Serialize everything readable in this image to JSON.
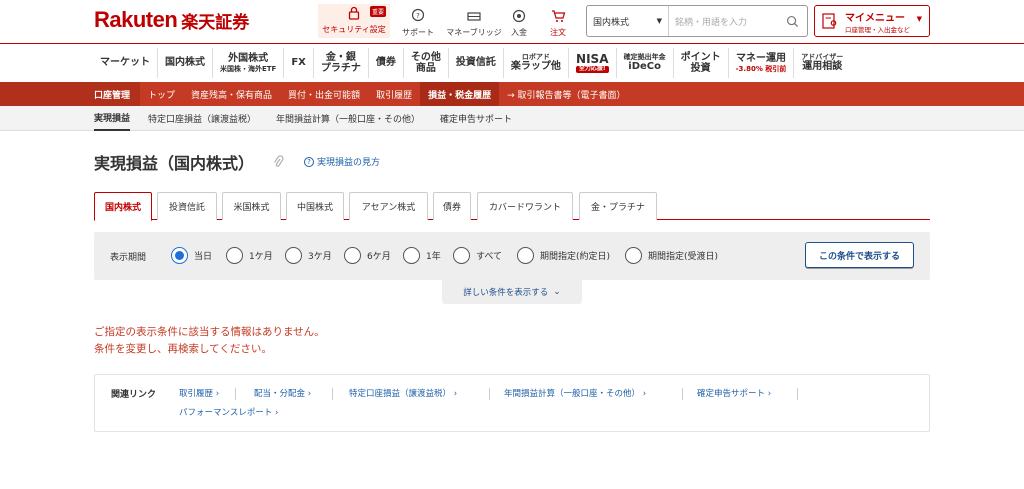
{
  "brand": {
    "name_en": "Rakuten",
    "name_jp": "楽天証券"
  },
  "header": {
    "security": {
      "label": "セキュリティ設定",
      "badge": "重要"
    },
    "support": "サポート",
    "money_bridge": "マネーブリッジ",
    "deposit": "入金",
    "order": "注文",
    "search": {
      "scope": "国内株式",
      "placeholder": "銘柄・用語を入力"
    },
    "mymenu": {
      "title": "マイメニュー",
      "sub": "口座管理・入出金など"
    }
  },
  "mainnav": [
    {
      "label": "マーケット"
    },
    {
      "label": "国内株式"
    },
    {
      "label": "外国株式",
      "sub": "米国株・海外ETF"
    },
    {
      "label": "FX"
    },
    {
      "label": "金・銀",
      "sub": "プラチナ"
    },
    {
      "label": "債券"
    },
    {
      "label": "その他",
      "sub": "商品"
    },
    {
      "label": "投資信託"
    },
    {
      "label": "ロボアド",
      "sub": "楽ラップ他"
    },
    {
      "label": "NISA",
      "tag": "全力応援!"
    },
    {
      "label": "確定拠出年金",
      "sub": "iDeCo"
    },
    {
      "label": "ポイント",
      "sub": "投資"
    },
    {
      "label": "マネー運用",
      "sub": "-3.80% 税引前"
    },
    {
      "label": "アドバイザー",
      "sub": "運用相談"
    }
  ],
  "accountnav": {
    "label": "口座管理",
    "items": [
      "トップ",
      "資産残高・保有商品",
      "買付・出金可能額",
      "取引履歴",
      "損益・税金履歴",
      "→ 取引報告書等（電子書面）"
    ]
  },
  "subnav": [
    "実現損益",
    "特定口座損益（譲渡益税）",
    "年間損益計算（一般口座・その他）",
    "確定申告サポート"
  ],
  "page": {
    "title": "実現損益（国内株式）",
    "help_link": "実現損益の見方"
  },
  "tabs": [
    "国内株式",
    "投資信託",
    "米国株式",
    "中国株式",
    "アセアン株式",
    "債券",
    "カバードワラント",
    "金・プラチナ"
  ],
  "filter": {
    "label": "表示期間",
    "options": [
      "当日",
      "1ケ月",
      "3ケ月",
      "6ケ月",
      "1年",
      "すべて",
      "期間指定(約定日)",
      "期間指定(受渡日)"
    ],
    "selected": "当日",
    "apply_label": "この条件で表示する",
    "more_label": "詳しい条件を表示する"
  },
  "message": {
    "line1": "ご指定の表示条件に該当する情報はありません。",
    "line2": "条件を変更し、再検索してください。"
  },
  "related": {
    "label": "関連リンク",
    "links": [
      "取引履歴",
      "配当・分配金",
      "特定口座損益（譲渡益税）",
      "年間損益計算（一般口座・その他）",
      "確定申告サポート",
      "パフォーマンスレポート"
    ]
  },
  "colors": {
    "brand_red": "#bf0000",
    "nav_red": "#c43a24",
    "link_blue": "#1f5fa8",
    "radio_blue": "#1f6fd8"
  }
}
